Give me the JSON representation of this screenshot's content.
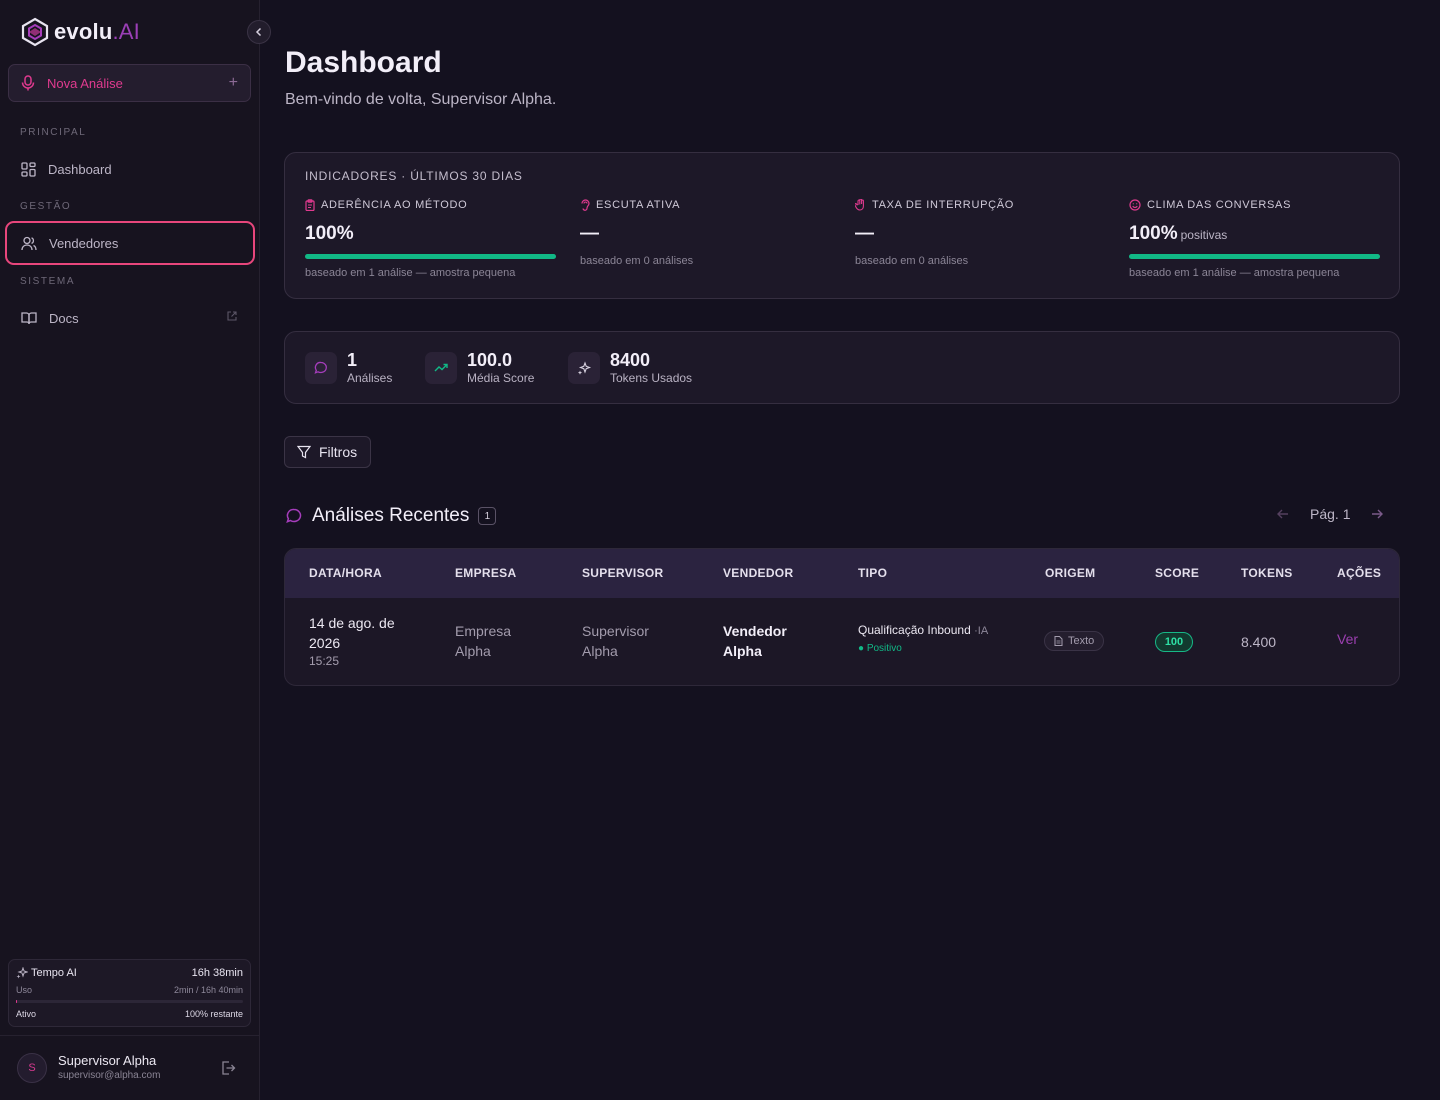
{
  "brand": {
    "name": "evolu",
    "suffix": ".AI"
  },
  "sidebar": {
    "new_analysis_label": "Nova Análise",
    "sections": {
      "principal": "PRINCIPAL",
      "gestao": "GESTÃO",
      "sistema": "SISTEMA"
    },
    "items": [
      {
        "label": "Dashboard",
        "icon": "dashboard-grid-icon"
      },
      {
        "label": "Vendedores",
        "icon": "users-icon",
        "active": true
      },
      {
        "label": "Docs",
        "icon": "book-icon",
        "external": true
      }
    ],
    "tempo": {
      "title": "Tempo AI",
      "total": "16h 38min",
      "usage_label": "Uso",
      "usage_value": "2min / 16h 40min",
      "usage_fraction": 0.002,
      "status_label": "Ativo",
      "remaining": "100% restante"
    },
    "user": {
      "initial": "S",
      "name": "Supervisor Alpha",
      "email": "supervisor@alpha.com"
    }
  },
  "header": {
    "title": "Dashboard",
    "subtitle": "Bem-vindo de volta, Supervisor Alpha."
  },
  "indicators": {
    "title": "INDICADORES · ÚLTIMOS 30 DIAS",
    "items": [
      {
        "label": "ADERÊNCIA AO MÉTODO",
        "icon": "clipboard-icon",
        "value": "100%",
        "suffix": "",
        "progress": 1.0,
        "note": "baseado em 1 análise — amostra pequena"
      },
      {
        "label": "ESCUTA ATIVA",
        "icon": "ear-icon",
        "value": "—",
        "suffix": "",
        "progress": null,
        "note": "baseado em 0 análises"
      },
      {
        "label": "TAXA DE INTERRUPÇÃO",
        "icon": "hand-icon",
        "value": "—",
        "suffix": "",
        "progress": null,
        "note": "baseado em 0 análises"
      },
      {
        "label": "CLIMA DAS CONVERSAS",
        "icon": "smile-icon",
        "value": "100%",
        "suffix": "positivas",
        "progress": 1.0,
        "note": "baseado em 1 análise — amostra pequena"
      }
    ]
  },
  "stats": [
    {
      "value": "1",
      "label": "Análises",
      "icon": "chat-bubble-icon"
    },
    {
      "value": "100.0",
      "label": "Média Score",
      "icon": "trending-up-icon"
    },
    {
      "value": "8400",
      "label": "Tokens Usados",
      "icon": "sparkles-icon"
    }
  ],
  "filters": {
    "label": "Filtros"
  },
  "recent": {
    "title": "Análises Recentes",
    "count": "1",
    "page_label": "Pág. 1",
    "columns": [
      "DATA/HORA",
      "EMPRESA",
      "SUPERVISOR",
      "VENDEDOR",
      "TIPO",
      "ORIGEM",
      "SCORE",
      "TOKENS",
      "AÇÕES"
    ],
    "rows": [
      {
        "date_line1": "14 de ago. de",
        "date_line2": "2026",
        "time": "15:25",
        "empresa_line1": "Empresa",
        "empresa_line2": "Alpha",
        "supervisor_line1": "Supervisor",
        "supervisor_line2": "Alpha",
        "vendedor_line1": "Vendedor",
        "vendedor_line2": "Alpha",
        "tipo": "Qualificação Inbound",
        "tipo_tag": "·IA",
        "sentiment": "● Positivo",
        "origem": "Texto",
        "score": "100",
        "tokens": "8.400",
        "action": "Ver"
      }
    ]
  },
  "colors": {
    "accent": "#e03a8f",
    "success": "#11b886",
    "active_border": "#e8467c",
    "background": "#14111f"
  }
}
